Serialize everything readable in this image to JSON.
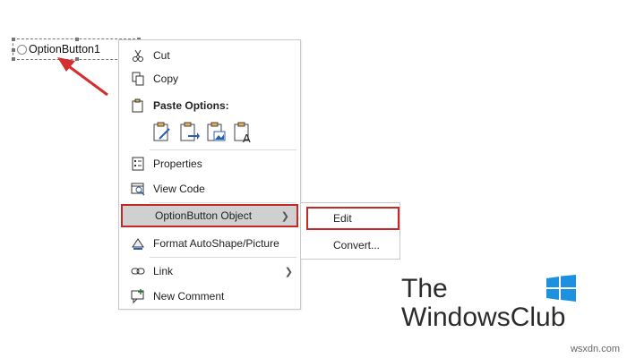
{
  "control": {
    "label": "OptionButton1"
  },
  "menu": {
    "cut": "Cut",
    "copy": "Copy",
    "paste_options": "Paste Options:",
    "properties": "Properties",
    "view_code": "View Code",
    "optionbutton_object": "OptionButton Object",
    "format_autoshape": "Format AutoShape/Picture",
    "link": "Link",
    "new_comment": "New Comment"
  },
  "submenu": {
    "edit": "Edit",
    "convert": "Convert..."
  },
  "logo": {
    "line1": "The",
    "line2": "WindowsClub"
  },
  "footer": {
    "site": "wsxdn.com"
  },
  "colors": {
    "highlight_border": "#c62828",
    "selected_bg": "#d0d0d0",
    "arrow": "#d32f2f"
  },
  "icons": [
    "scissors-icon",
    "copy-icon",
    "paste-icon",
    "properties-icon",
    "view-code-icon",
    "format-shape-icon",
    "link-icon",
    "comment-icon",
    "windows-logo-icon"
  ]
}
